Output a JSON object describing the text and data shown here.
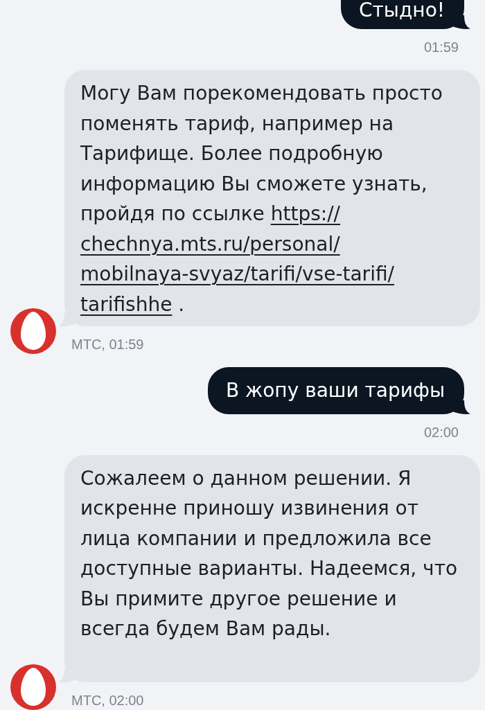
{
  "messages": [
    {
      "kind": "outgoing",
      "text": "Стыдно!",
      "time": "01:59"
    },
    {
      "kind": "incoming",
      "text": "Могу Вам порекомендовать просто поменять тариф, например на Тарифище. Более подробную информацию Вы сможете узнать, пройдя по ссылке",
      "link_lines": [
        "https://",
        "chechnya.mts.ru/personal/",
        "mobilnaya-svyaz/tarifi/vse-tarifi/",
        "tarifishhe"
      ],
      "text_after": ".",
      "meta": "МТС, 01:59"
    },
    {
      "kind": "outgoing",
      "text": "В жопу ваши тарифы",
      "time": "02:00"
    },
    {
      "kind": "incoming",
      "text": "Сожалеем о данном решении. Я искренне приношу извинения от лица компании и предложила все доступные варианты. Надеемся, что Вы примите другое решение и всегда будем Вам рады.",
      "meta": "МТС, 02:00"
    }
  ]
}
